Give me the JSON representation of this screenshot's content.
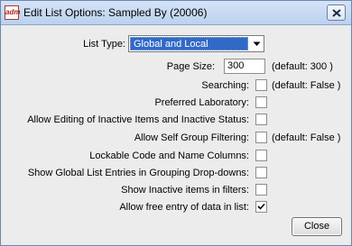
{
  "window": {
    "title": "Edit List Options: Sampled By (20006)",
    "app_icon_text": "adm"
  },
  "list_type": {
    "label": "List Type:",
    "selected": "Global and Local"
  },
  "page_size": {
    "label": "Page Size:",
    "value": "300",
    "default_note": "(default: 300   )"
  },
  "options": [
    {
      "label": "Searching:",
      "checked": false,
      "default_note": "(default: False )"
    },
    {
      "label": "Preferred Laboratory:",
      "checked": false,
      "default_note": ""
    },
    {
      "label": "Allow Editing of Inactive Items and Inactive Status:",
      "checked": false,
      "default_note": ""
    },
    {
      "label": "Allow Self Group Filtering:",
      "checked": false,
      "default_note": "(default: False )"
    },
    {
      "label": "Lockable Code and Name Columns:",
      "checked": false,
      "default_note": ""
    },
    {
      "label": "Show Global List Entries in Grouping Drop-downs:",
      "checked": false,
      "default_note": ""
    },
    {
      "label": "Show Inactive items in filters:",
      "checked": false,
      "default_note": ""
    },
    {
      "label": "Allow  free entry of data in list:",
      "checked": true,
      "default_note": ""
    }
  ],
  "buttons": {
    "close": "Close"
  }
}
